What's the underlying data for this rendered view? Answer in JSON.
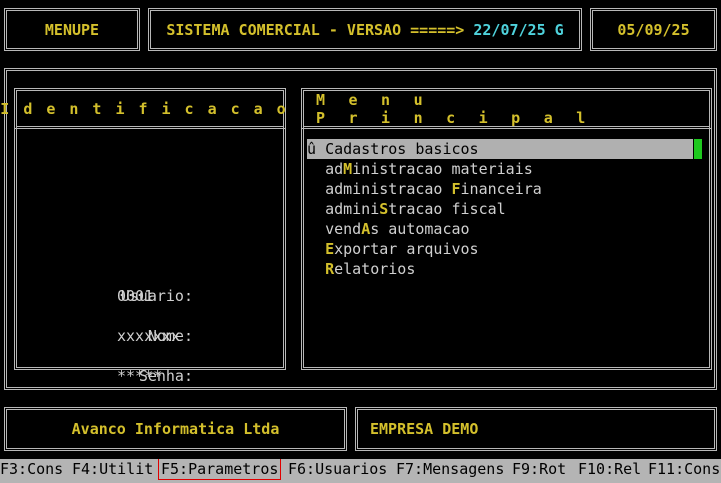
{
  "header": {
    "program": "MENUPE",
    "system_title": "SISTEMA COMERCIAL - VERSAO =====>",
    "version": "22/07/25 G",
    "date": "05/09/25"
  },
  "identification": {
    "title": "Identificacao",
    "usuario_label": "Usuario:",
    "usuario_value": "0001",
    "nome_label": "Nome:",
    "nome_value": "xxxxxxx",
    "senha_label": "Senha:",
    "senha_value": "*****"
  },
  "menu": {
    "title": "Menu Principal",
    "items": [
      {
        "prefix": "û ",
        "pre": "",
        "hot": "C",
        "post": "adastros basicos",
        "selected": true
      },
      {
        "prefix": "  ",
        "pre": "ad",
        "hot": "M",
        "post": "inistracao materiais"
      },
      {
        "prefix": "  ",
        "pre": "administracao ",
        "hot": "F",
        "post": "inanceira"
      },
      {
        "prefix": "  ",
        "pre": "admini",
        "hot": "S",
        "post": "tracao fiscal"
      },
      {
        "prefix": "  ",
        "pre": "vend",
        "hot": "A",
        "post": "s automacao"
      },
      {
        "prefix": "  ",
        "pre": "",
        "hot": "E",
        "post": "xportar arquivos"
      },
      {
        "prefix": "  ",
        "pre": "",
        "hot": "R",
        "post": "elatorios"
      }
    ]
  },
  "footer": {
    "company": "Avanco Informatica Ltda",
    "empresa": "EMPRESA DEMO"
  },
  "function_keys": [
    {
      "key": "F3:Cons"
    },
    {
      "key": "F4:Utilit"
    },
    {
      "key": "F5:Parametros",
      "highlighted": true
    },
    {
      "key": "F6:Usuarios"
    },
    {
      "key": "F7:Mensagens"
    },
    {
      "key": "F9:Rot"
    },
    {
      "key": "F10:Rel"
    },
    {
      "key": "F11:Cons"
    }
  ],
  "colors": {
    "background": "#000000",
    "title_yellow": "#d4c02c",
    "version_cyan": "#4fd2dc",
    "selection_bg": "#b0b0b0",
    "cursor_green": "#1ec81e",
    "highlight_red": "#e00000"
  }
}
